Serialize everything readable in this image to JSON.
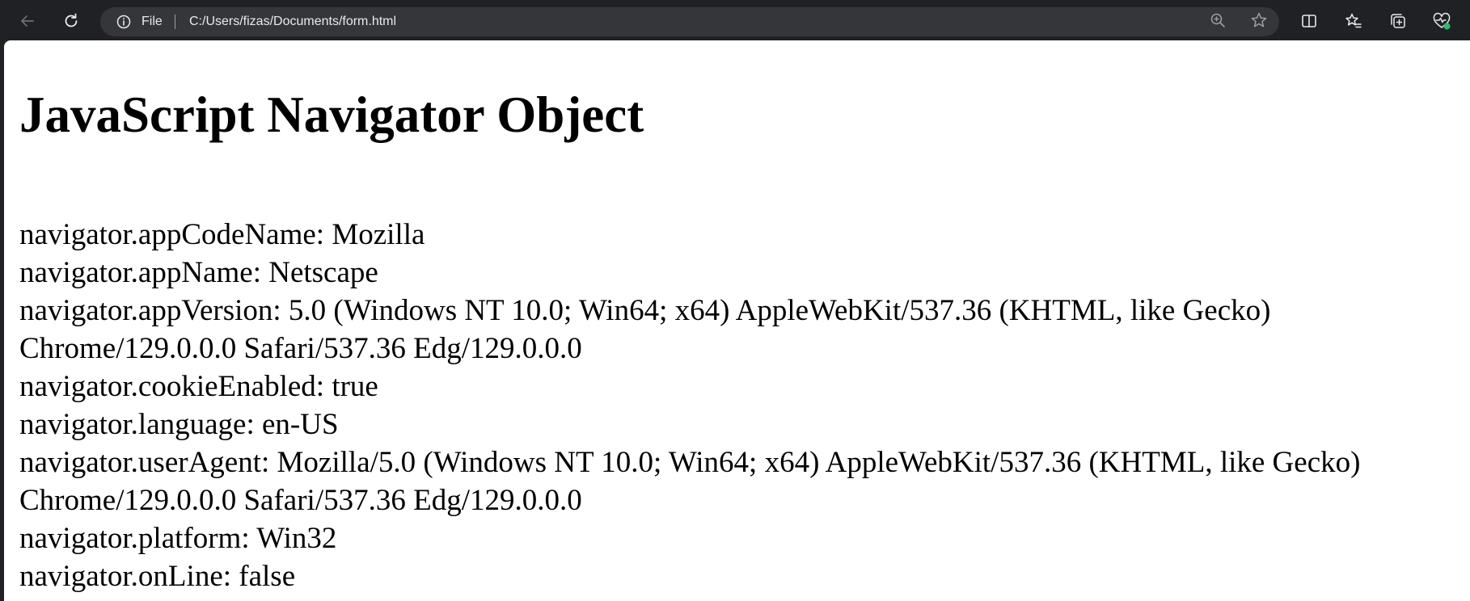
{
  "browser": {
    "address": {
      "scheme_label": "File",
      "url": "C:/Users/fizas/Documents/form.html"
    },
    "icons": {
      "back": "arrow-left-icon",
      "reload": "reload-icon",
      "info": "info-icon",
      "zoom": "zoom-in-icon",
      "favorite": "star-icon",
      "split_screen": "split-screen-icon",
      "favorites": "favorites-icon",
      "collections": "collections-icon",
      "browser_essentials": "heart-pulse-icon"
    },
    "colors": {
      "frame": "#202124",
      "address_bar": "#35363a",
      "badge_green": "#2fb96b"
    }
  },
  "page": {
    "title": "JavaScript Navigator Object",
    "lines": [
      "navigator.appCodeName: Mozilla",
      "navigator.appName: Netscape",
      "navigator.appVersion: 5.0 (Windows NT 10.0; Win64; x64) AppleWebKit/537.36 (KHTML, like Gecko)",
      "Chrome/129.0.0.0 Safari/537.36 Edg/129.0.0.0",
      "navigator.cookieEnabled: true",
      "navigator.language: en-US",
      "navigator.userAgent: Mozilla/5.0 (Windows NT 10.0; Win64; x64) AppleWebKit/537.36 (KHTML, like Gecko)",
      "Chrome/129.0.0.0 Safari/537.36 Edg/129.0.0.0",
      "navigator.platform: Win32",
      "navigator.onLine: false"
    ]
  }
}
